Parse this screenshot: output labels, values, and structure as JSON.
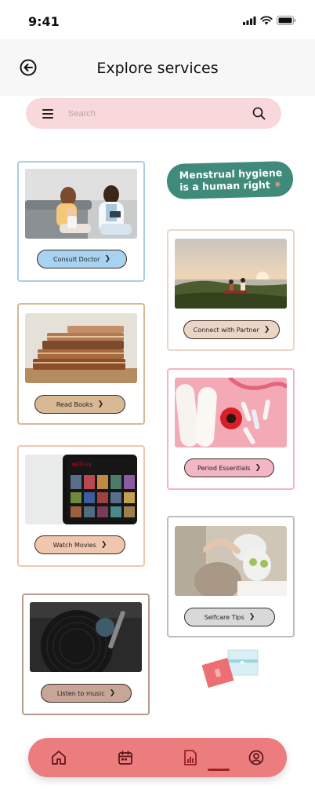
{
  "status_bar": {
    "time": "9:41"
  },
  "header": {
    "title": "Explore services",
    "back_icon": "back-arrow-circle-icon"
  },
  "search": {
    "placeholder": "Search",
    "value": ""
  },
  "banner": {
    "text": "Menstrual hygiene is a human right",
    "star": "✷",
    "bg_color": "#3f8a7a"
  },
  "services": [
    {
      "label": "Consult Doctor",
      "image": "doctor-consultation-photo",
      "accent": "#a7d3f0"
    },
    {
      "label": "Connect with Partner",
      "image": "couple-picnic-sunset-photo",
      "accent": "#ead6c6"
    },
    {
      "label": "Read Books",
      "image": "stacked-old-books-photo",
      "accent": "#d9b895"
    },
    {
      "label": "Period Essentials",
      "image": "pads-tampons-flower-photo",
      "accent": "#f3b6c3"
    },
    {
      "label": "Watch Movies",
      "image": "netflix-tablet-photo",
      "accent": "#f1c6ae"
    },
    {
      "label": "Selfcare Tips",
      "image": "face-mask-cucumber-photo",
      "accent": "#d9d9d9"
    },
    {
      "label": "Listen to music",
      "image": "vinyl-record-player-photo",
      "accent": "#c7a698"
    }
  ],
  "chevron": "❯",
  "bottom_nav": {
    "items": [
      "home-icon",
      "calendar-icon",
      "report-icon",
      "profile-icon"
    ],
    "active": "report-icon",
    "bg_color": "#eb7d7e"
  }
}
